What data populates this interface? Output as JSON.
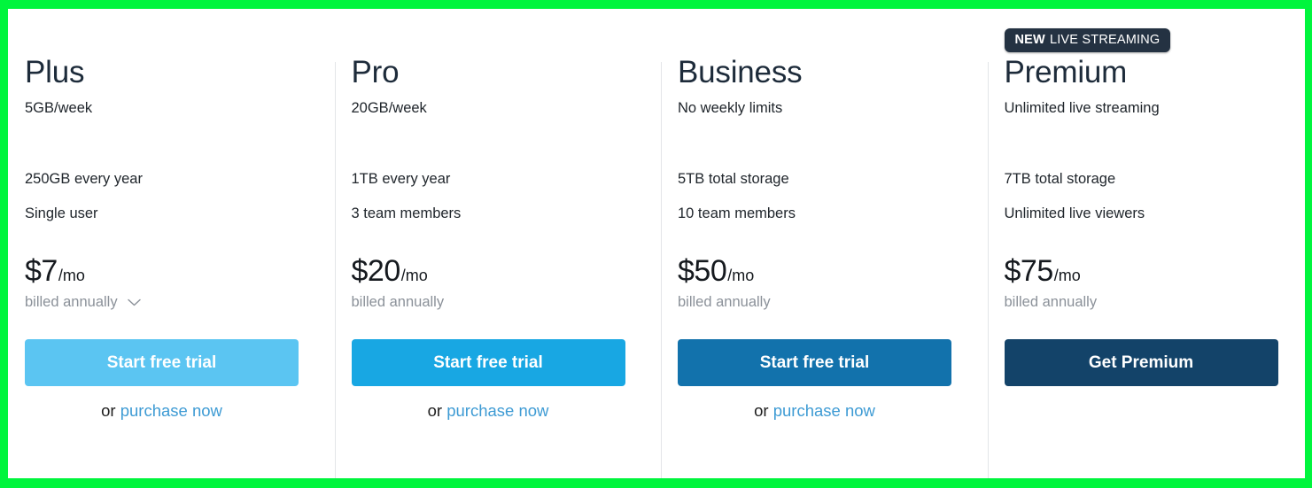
{
  "page": {
    "background_border_color": "#00F53D",
    "panel_background": "#FFFFFF",
    "divider_color": "#E3E5E8"
  },
  "badge": {
    "highlight": "NEW",
    "label": "LIVE STREAMING",
    "background": "#243242",
    "text_color": "#FFFFFF"
  },
  "plans": [
    {
      "name": "Plus",
      "subtitle": "5GB/week",
      "features": [
        "250GB every year",
        "Single user"
      ],
      "price_amount": "$7",
      "price_period": "/mo",
      "billing": "billed annually",
      "has_billing_chevron": true,
      "cta_label": "Start free trial",
      "cta_color": "#5BC5F2",
      "purchase_prefix": "or ",
      "purchase_link": "purchase now",
      "has_purchase": true,
      "has_badge": false
    },
    {
      "name": "Pro",
      "subtitle": "20GB/week",
      "features": [
        "1TB every year",
        "3 team members"
      ],
      "price_amount": "$20",
      "price_period": "/mo",
      "billing": "billed annually",
      "has_billing_chevron": false,
      "cta_label": "Start free trial",
      "cta_color": "#18A7E3",
      "purchase_prefix": "or ",
      "purchase_link": "purchase now",
      "has_purchase": true,
      "has_badge": false
    },
    {
      "name": "Business",
      "subtitle": "No weekly limits",
      "features": [
        "5TB total storage",
        "10 team members"
      ],
      "price_amount": "$50",
      "price_period": "/mo",
      "billing": "billed annually",
      "has_billing_chevron": false,
      "cta_label": "Start free trial",
      "cta_color": "#1272AC",
      "purchase_prefix": "or ",
      "purchase_link": "purchase now",
      "has_purchase": true,
      "has_badge": false
    },
    {
      "name": "Premium",
      "subtitle": "Unlimited live streaming",
      "features": [
        "7TB total storage",
        "Unlimited live viewers"
      ],
      "price_amount": "$75",
      "price_period": "/mo",
      "billing": "billed annually",
      "has_billing_chevron": false,
      "cta_label": "Get Premium",
      "cta_color": "#134369",
      "purchase_prefix": "",
      "purchase_link": "",
      "has_purchase": false,
      "has_badge": true
    }
  ]
}
